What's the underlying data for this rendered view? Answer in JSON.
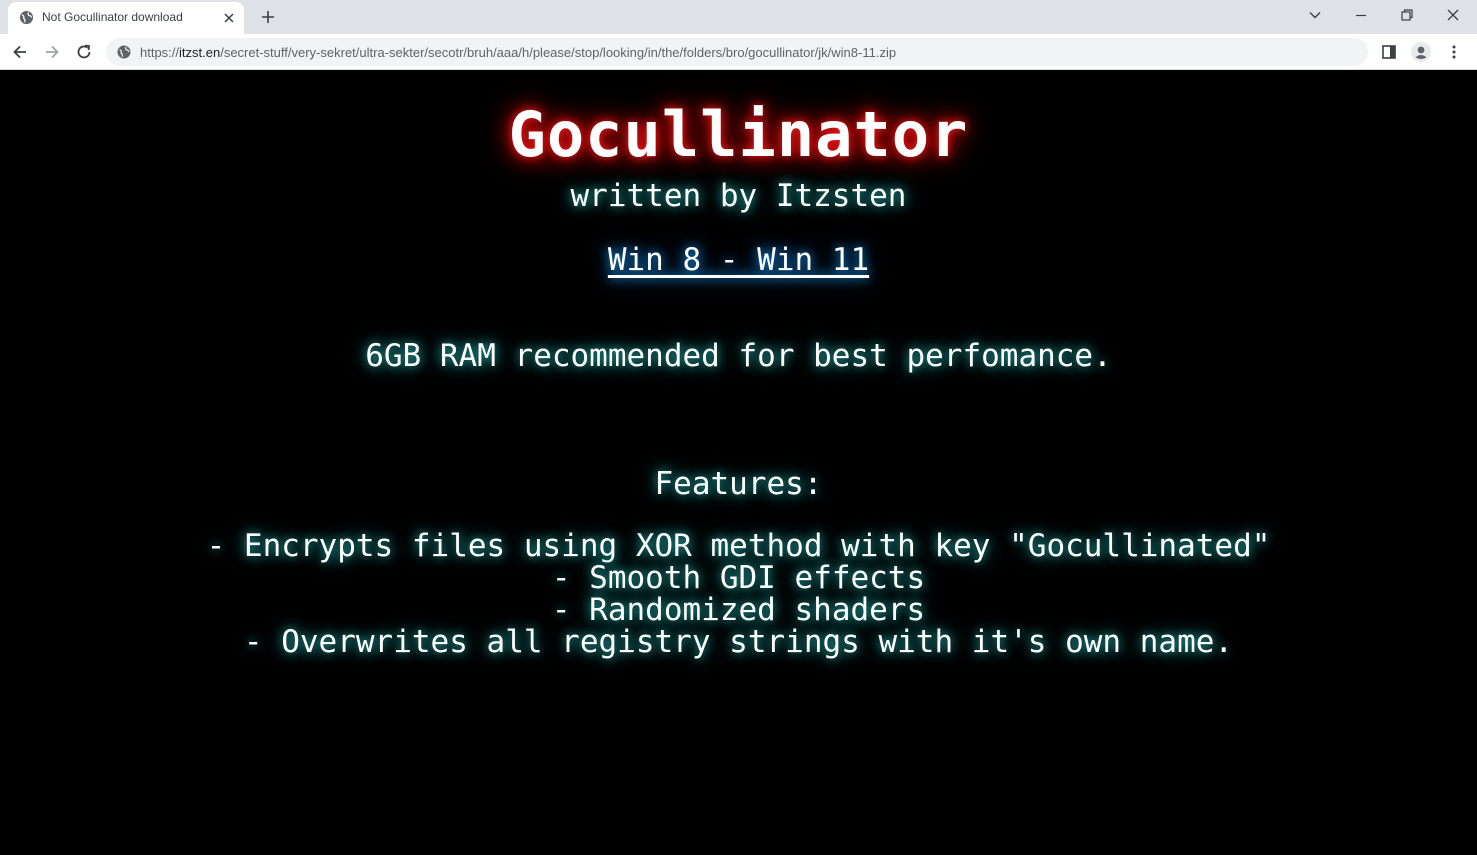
{
  "browser": {
    "tab": {
      "title": "Not Gocullinator download",
      "favicon": "globe-icon",
      "close_icon": "close-icon"
    },
    "new_tab_icon": "plus-icon",
    "window_controls": [
      "chevron-down-icon",
      "minimize-icon",
      "restore-icon",
      "close-icon"
    ],
    "toolbar": {
      "back_icon": "arrow-left-icon",
      "forward_icon": "arrow-right-icon",
      "reload_icon": "reload-icon",
      "site_info_icon": "site-info-icon",
      "url_scheme": "https://",
      "url_host": "itzst.en",
      "url_path": "/secret-stuff/very-sekret/ultra-sekter/secotr/bruh/aaa/h/please/stop/looking/in/the/folders/bro/gocullinator/jk/win8-11.zip",
      "side_panel_icon": "side-panel-icon",
      "profile_icon": "profile-icon",
      "menu_icon": "kebab-menu-icon"
    }
  },
  "page": {
    "title": "Gocullinator",
    "subtitle": "written by Itzsten",
    "compat_link": "Win 8 - Win 11",
    "ram_note": "6GB RAM recommended for best perfomance.",
    "features_heading": "Features:",
    "features": [
      "- Encrypts files using XOR method with key \"Gocullinated\"",
      "- Smooth GDI effects",
      "- Randomized shaders",
      "- Overwrites all registry strings with it's own name."
    ]
  },
  "colors": {
    "background": "#000000",
    "title_glow": "#ff1a1a",
    "text_glow": "#2fb7b7",
    "link_glow": "#1ea0ff"
  }
}
